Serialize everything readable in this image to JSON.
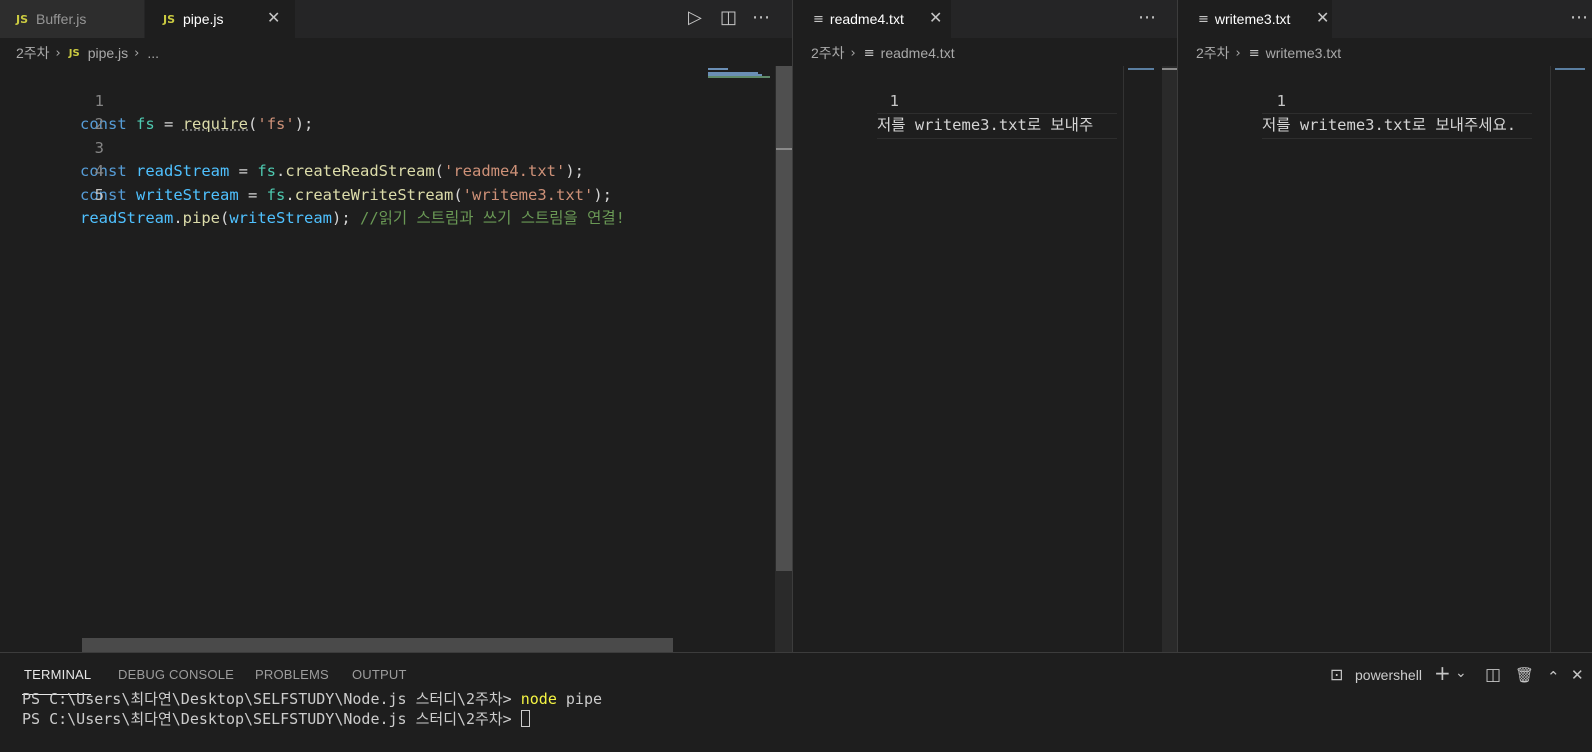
{
  "editor1": {
    "tabs": [
      {
        "label": "Buffer.js",
        "badge": "JS"
      },
      {
        "label": "pipe.js",
        "badge": "JS"
      }
    ],
    "breadcrumb": {
      "folder": "2주차",
      "file_badge": "JS",
      "file": "pipe.js",
      "more": "..."
    },
    "lines": [
      {
        "n": "1",
        "tokens": [
          "const",
          " ",
          "fs",
          " = ",
          "require",
          "(",
          "'fs'",
          ");"
        ]
      },
      {
        "n": "2"
      },
      {
        "n": "3",
        "tokens": [
          "const",
          " ",
          "readStream",
          " = ",
          "fs",
          ".",
          "createReadStream",
          "(",
          "'readme4.txt'",
          ");"
        ]
      },
      {
        "n": "4",
        "tokens": [
          "const",
          " ",
          "writeStream",
          " = ",
          "fs",
          ".",
          "createWriteStream",
          "(",
          "'writeme3.txt'",
          ");"
        ]
      },
      {
        "n": "5",
        "tokens": [
          "readStream",
          ".",
          "pipe",
          "(",
          "writeStream",
          "); ",
          "//읽기 스트림과 쓰기 스트림을 연결!"
        ]
      }
    ]
  },
  "editor2": {
    "tab": "readme4.txt",
    "breadcrumb": {
      "folder": "2주차",
      "file": "readme4.txt"
    },
    "line_number": "1",
    "content": "저를 writeme3.txt로 보내주"
  },
  "editor3": {
    "tab": "writeme3.txt",
    "breadcrumb": {
      "folder": "2주차",
      "file": "writeme3.txt"
    },
    "line_number": "1",
    "content": "저를 writeme3.txt로 보내주세요."
  },
  "panel": {
    "tabs": [
      "TERMINAL",
      "DEBUG CONSOLE",
      "PROBLEMS",
      "OUTPUT"
    ],
    "shell": "powershell",
    "terminal": [
      {
        "prompt": "PS C:\\Users\\최다연\\Desktop\\SELFSTUDY\\Node.js 스터디\\2주차> ",
        "cmd": "node",
        "args": " pipe"
      },
      {
        "prompt": "PS C:\\Users\\최다연\\Desktop\\SELFSTUDY\\Node.js 스터디\\2주차> "
      }
    ]
  },
  "icons": {
    "more": "⋯",
    "close": "✕",
    "run": "▷",
    "split": "◫",
    "chevron": "›",
    "plus": "+",
    "chevron_down": "⌄",
    "trash": "🗑",
    "chevron_up": "⌃",
    "terminal": "⊡"
  }
}
